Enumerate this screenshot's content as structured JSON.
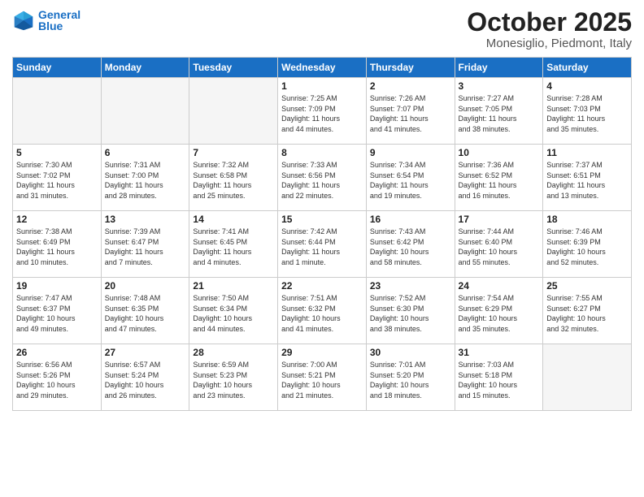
{
  "header": {
    "logo_line1": "General",
    "logo_line2": "Blue",
    "month_title": "October 2025",
    "subtitle": "Monesiglio, Piedmont, Italy"
  },
  "weekdays": [
    "Sunday",
    "Monday",
    "Tuesday",
    "Wednesday",
    "Thursday",
    "Friday",
    "Saturday"
  ],
  "weeks": [
    [
      {
        "day": "",
        "info": ""
      },
      {
        "day": "",
        "info": ""
      },
      {
        "day": "",
        "info": ""
      },
      {
        "day": "1",
        "info": "Sunrise: 7:25 AM\nSunset: 7:09 PM\nDaylight: 11 hours\nand 44 minutes."
      },
      {
        "day": "2",
        "info": "Sunrise: 7:26 AM\nSunset: 7:07 PM\nDaylight: 11 hours\nand 41 minutes."
      },
      {
        "day": "3",
        "info": "Sunrise: 7:27 AM\nSunset: 7:05 PM\nDaylight: 11 hours\nand 38 minutes."
      },
      {
        "day": "4",
        "info": "Sunrise: 7:28 AM\nSunset: 7:03 PM\nDaylight: 11 hours\nand 35 minutes."
      }
    ],
    [
      {
        "day": "5",
        "info": "Sunrise: 7:30 AM\nSunset: 7:02 PM\nDaylight: 11 hours\nand 31 minutes."
      },
      {
        "day": "6",
        "info": "Sunrise: 7:31 AM\nSunset: 7:00 PM\nDaylight: 11 hours\nand 28 minutes."
      },
      {
        "day": "7",
        "info": "Sunrise: 7:32 AM\nSunset: 6:58 PM\nDaylight: 11 hours\nand 25 minutes."
      },
      {
        "day": "8",
        "info": "Sunrise: 7:33 AM\nSunset: 6:56 PM\nDaylight: 11 hours\nand 22 minutes."
      },
      {
        "day": "9",
        "info": "Sunrise: 7:34 AM\nSunset: 6:54 PM\nDaylight: 11 hours\nand 19 minutes."
      },
      {
        "day": "10",
        "info": "Sunrise: 7:36 AM\nSunset: 6:52 PM\nDaylight: 11 hours\nand 16 minutes."
      },
      {
        "day": "11",
        "info": "Sunrise: 7:37 AM\nSunset: 6:51 PM\nDaylight: 11 hours\nand 13 minutes."
      }
    ],
    [
      {
        "day": "12",
        "info": "Sunrise: 7:38 AM\nSunset: 6:49 PM\nDaylight: 11 hours\nand 10 minutes."
      },
      {
        "day": "13",
        "info": "Sunrise: 7:39 AM\nSunset: 6:47 PM\nDaylight: 11 hours\nand 7 minutes."
      },
      {
        "day": "14",
        "info": "Sunrise: 7:41 AM\nSunset: 6:45 PM\nDaylight: 11 hours\nand 4 minutes."
      },
      {
        "day": "15",
        "info": "Sunrise: 7:42 AM\nSunset: 6:44 PM\nDaylight: 11 hours\nand 1 minute."
      },
      {
        "day": "16",
        "info": "Sunrise: 7:43 AM\nSunset: 6:42 PM\nDaylight: 10 hours\nand 58 minutes."
      },
      {
        "day": "17",
        "info": "Sunrise: 7:44 AM\nSunset: 6:40 PM\nDaylight: 10 hours\nand 55 minutes."
      },
      {
        "day": "18",
        "info": "Sunrise: 7:46 AM\nSunset: 6:39 PM\nDaylight: 10 hours\nand 52 minutes."
      }
    ],
    [
      {
        "day": "19",
        "info": "Sunrise: 7:47 AM\nSunset: 6:37 PM\nDaylight: 10 hours\nand 49 minutes."
      },
      {
        "day": "20",
        "info": "Sunrise: 7:48 AM\nSunset: 6:35 PM\nDaylight: 10 hours\nand 47 minutes."
      },
      {
        "day": "21",
        "info": "Sunrise: 7:50 AM\nSunset: 6:34 PM\nDaylight: 10 hours\nand 44 minutes."
      },
      {
        "day": "22",
        "info": "Sunrise: 7:51 AM\nSunset: 6:32 PM\nDaylight: 10 hours\nand 41 minutes."
      },
      {
        "day": "23",
        "info": "Sunrise: 7:52 AM\nSunset: 6:30 PM\nDaylight: 10 hours\nand 38 minutes."
      },
      {
        "day": "24",
        "info": "Sunrise: 7:54 AM\nSunset: 6:29 PM\nDaylight: 10 hours\nand 35 minutes."
      },
      {
        "day": "25",
        "info": "Sunrise: 7:55 AM\nSunset: 6:27 PM\nDaylight: 10 hours\nand 32 minutes."
      }
    ],
    [
      {
        "day": "26",
        "info": "Sunrise: 6:56 AM\nSunset: 5:26 PM\nDaylight: 10 hours\nand 29 minutes."
      },
      {
        "day": "27",
        "info": "Sunrise: 6:57 AM\nSunset: 5:24 PM\nDaylight: 10 hours\nand 26 minutes."
      },
      {
        "day": "28",
        "info": "Sunrise: 6:59 AM\nSunset: 5:23 PM\nDaylight: 10 hours\nand 23 minutes."
      },
      {
        "day": "29",
        "info": "Sunrise: 7:00 AM\nSunset: 5:21 PM\nDaylight: 10 hours\nand 21 minutes."
      },
      {
        "day": "30",
        "info": "Sunrise: 7:01 AM\nSunset: 5:20 PM\nDaylight: 10 hours\nand 18 minutes."
      },
      {
        "day": "31",
        "info": "Sunrise: 7:03 AM\nSunset: 5:18 PM\nDaylight: 10 hours\nand 15 minutes."
      },
      {
        "day": "",
        "info": ""
      }
    ]
  ]
}
